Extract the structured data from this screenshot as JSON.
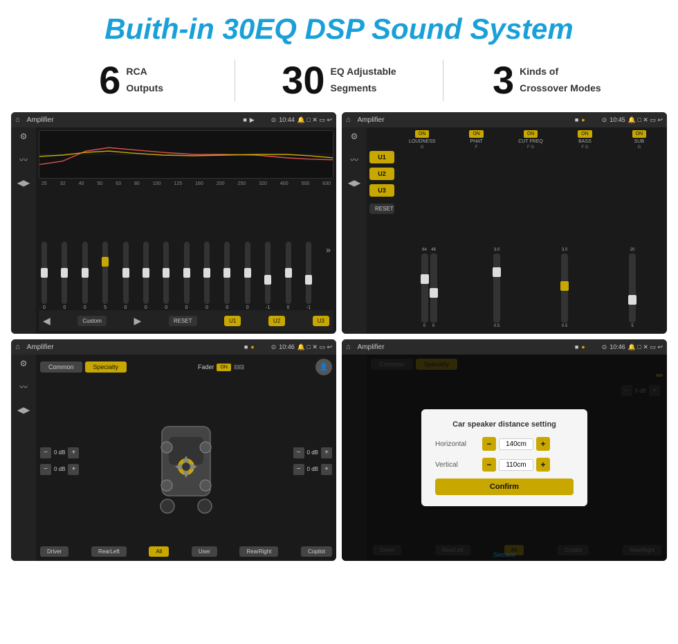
{
  "header": {
    "title": "Buith-in 30EQ DSP Sound System"
  },
  "stats": [
    {
      "number": "6",
      "label_line1": "RCA",
      "label_line2": "Outputs"
    },
    {
      "number": "30",
      "label_line1": "EQ Adjustable",
      "label_line2": "Segments"
    },
    {
      "number": "3",
      "label_line1": "Kinds of",
      "label_line2": "Crossover Modes"
    }
  ],
  "screens": {
    "eq": {
      "title": "Amplifier",
      "time": "10:44",
      "frequencies": [
        "25",
        "32",
        "40",
        "50",
        "63",
        "80",
        "100",
        "125",
        "160",
        "200",
        "250",
        "320",
        "400",
        "500",
        "630"
      ],
      "values": [
        "0",
        "0",
        "0",
        "5",
        "0",
        "0",
        "0",
        "0",
        "0",
        "0",
        "0",
        "-1",
        "0",
        "-1"
      ],
      "preset": "Custom",
      "buttons": [
        "RESET",
        "U1",
        "U2",
        "U3"
      ]
    },
    "crossover": {
      "title": "Amplifier",
      "time": "10:45",
      "channels": [
        "LOUDNESS",
        "PHAT",
        "CUT FREQ",
        "BASS",
        "SUB"
      ],
      "u_buttons": [
        "U1",
        "U2",
        "U3"
      ],
      "reset_label": "RESET"
    },
    "fader": {
      "title": "Amplifier",
      "time": "10:46",
      "tabs": [
        "Common",
        "Specialty"
      ],
      "fader_label": "Fader",
      "on_label": "ON",
      "positions": [
        "Driver",
        "RearLeft",
        "All",
        "User",
        "RearRight",
        "Copilot"
      ],
      "db_values": [
        "0 dB",
        "0 dB",
        "0 dB",
        "0 dB"
      ]
    },
    "dialog": {
      "title": "Amplifier",
      "time": "10:46",
      "dialog_title": "Car speaker distance setting",
      "horizontal_label": "Horizontal",
      "horizontal_value": "140cm",
      "vertical_label": "Vertical",
      "vertical_value": "110cm",
      "confirm_label": "Confirm",
      "positions": [
        "Driver",
        "RearLeft",
        "Copilot",
        "RearRight"
      ],
      "db_right": "0 dB",
      "seicane": "Seicane"
    }
  }
}
